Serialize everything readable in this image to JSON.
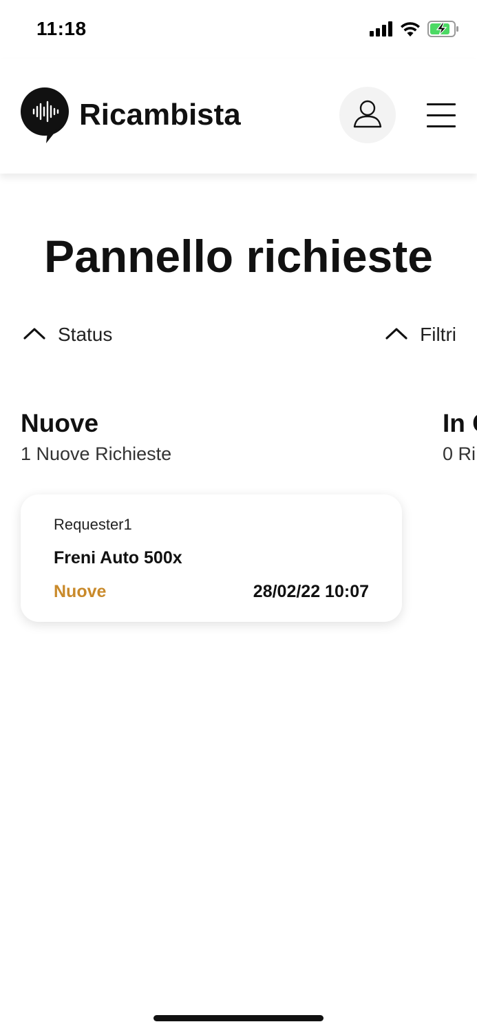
{
  "status_bar": {
    "time": "11:18",
    "icons": [
      "cellular-signal-icon",
      "wifi-icon",
      "battery-charging-icon"
    ],
    "battery_color": "#4cd964"
  },
  "header": {
    "app_name": "Ricambista",
    "logo_icon": "soundwave-bubble-icon",
    "profile_icon": "user-icon",
    "menu_icon": "hamburger-menu-icon"
  },
  "page": {
    "title": "Pannello richieste"
  },
  "toggles": {
    "status_label": "Status",
    "filter_label": "Filtri"
  },
  "columns": [
    {
      "title": "Nuove",
      "subtitle": "1 Nuove Richieste"
    },
    {
      "title": "In C",
      "subtitle": "0 Ri"
    }
  ],
  "cards": [
    {
      "requester": "Requester1",
      "item": "Freni Auto 500x",
      "status": "Nuove",
      "datetime": "28/02/22 10:07"
    }
  ],
  "colors": {
    "accent_status": "#c98a2b"
  }
}
